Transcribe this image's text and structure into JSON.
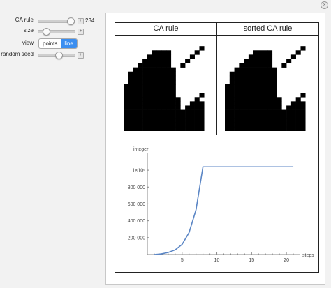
{
  "controls": {
    "ca_rule": {
      "label": "CA rule",
      "value": "234",
      "level": 0.92
    },
    "size": {
      "label": "size",
      "level": 0.15
    },
    "view": {
      "label": "view",
      "options": [
        "points",
        "line"
      ],
      "selected": "line"
    },
    "random_seed": {
      "label": "random seed",
      "level": 0.55
    }
  },
  "panel": {
    "col1_title": "CA rule",
    "col2_title": "sorted CA rule"
  },
  "ca_grid": [
    "000000000000000000",
    "000000000000000000",
    "000000000000000010",
    "000000111100000100",
    "000001111100001000",
    "000011111100010000",
    "000111111100100000",
    "001111111110000000",
    "011111111110000000",
    "011111111110000000",
    "011111111110000000",
    "111111111110000000",
    "111111111110000000",
    "111111111110000010",
    "111111111111000100",
    "111111111111001110",
    "111111111111011110",
    "111111111111111110",
    "111111111111111110",
    "111111111111111110",
    "111111111111111110",
    "111111111111111110"
  ],
  "chart_data": {
    "type": "line",
    "ylabel": "integer",
    "xlabel": "steps",
    "x": [
      1,
      2,
      3,
      4,
      5,
      6,
      7,
      8,
      9,
      10,
      11,
      12,
      13,
      14,
      15,
      16,
      17,
      18,
      19,
      20,
      21
    ],
    "y": [
      0,
      8000,
      25000,
      55000,
      120000,
      260000,
      530000,
      1040000,
      1040000,
      1040000,
      1040000,
      1040000,
      1040000,
      1040000,
      1040000,
      1040000,
      1040000,
      1040000,
      1040000,
      1040000,
      1040000
    ],
    "xlim": [
      0,
      22
    ],
    "ylim": [
      0,
      1100000
    ],
    "x_ticks": [
      "5",
      "10",
      "15",
      "20"
    ],
    "y_ticks": [
      "200 000",
      "400 000",
      "600 000",
      "800 000",
      "1×10⁶"
    ],
    "line_color": "#5b86c5"
  }
}
